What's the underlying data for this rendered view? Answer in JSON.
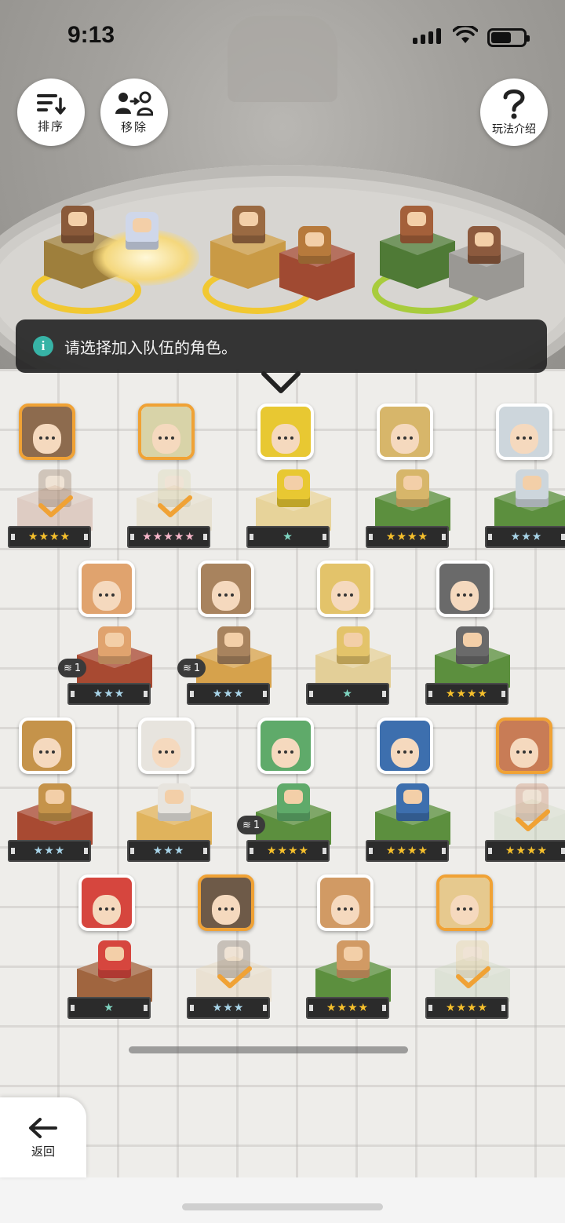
{
  "status": {
    "time": "9:13"
  },
  "toolbar": {
    "sort_label": "排序",
    "remove_label": "移除",
    "help_label": "玩法介绍",
    "back_label": "返回"
  },
  "banner": {
    "text": "请选择加入队伍的角色。"
  },
  "colors": {
    "owned_frame": "#f0a235",
    "fire": "#d93a3a",
    "lightning": "#f0b414",
    "wind": "#46b43c",
    "light": "#e3b640"
  },
  "characters": [
    {
      "element": "fire",
      "stars": "★★★★",
      "star_style": "gold",
      "owned": true,
      "selected": true,
      "duplicate": ""
    },
    {
      "element": "lightning",
      "stars": "★★★★★",
      "star_style": "rainbow",
      "owned": true,
      "selected": true,
      "duplicate": ""
    },
    {
      "element": "lightning",
      "stars": "★",
      "star_style": "teal",
      "owned": false,
      "selected": false,
      "duplicate": ""
    },
    {
      "element": "wind",
      "stars": "★★★★",
      "star_style": "gold",
      "owned": false,
      "selected": false,
      "duplicate": ""
    },
    {
      "element": "wind",
      "stars": "★★★",
      "star_style": "silver",
      "owned": false,
      "selected": false,
      "duplicate": ""
    },
    {
      "element": "fire",
      "stars": "★★★",
      "star_style": "silver",
      "owned": false,
      "selected": false,
      "duplicate": "1"
    },
    {
      "element": "lightning",
      "stars": "★★★",
      "star_style": "silver",
      "owned": false,
      "selected": false,
      "duplicate": "1"
    },
    {
      "element": "lightning",
      "stars": "★",
      "star_style": "teal",
      "owned": false,
      "selected": false,
      "duplicate": ""
    },
    {
      "element": "wind",
      "stars": "★★★★",
      "star_style": "gold",
      "owned": false,
      "selected": false,
      "duplicate": ""
    },
    {
      "element": "fire",
      "stars": "★★★",
      "star_style": "silver",
      "owned": false,
      "selected": false,
      "duplicate": ""
    },
    {
      "element": "lightning",
      "stars": "★★★",
      "star_style": "silver",
      "owned": false,
      "selected": false,
      "duplicate": ""
    },
    {
      "element": "wind",
      "stars": "★★★★",
      "star_style": "gold",
      "owned": false,
      "selected": false,
      "duplicate": "1"
    },
    {
      "element": "wind",
      "stars": "★★★★",
      "star_style": "gold",
      "owned": false,
      "selected": false,
      "duplicate": ""
    },
    {
      "element": "light",
      "stars": "★★★★",
      "star_style": "gold",
      "owned": true,
      "selected": true,
      "duplicate": ""
    },
    {
      "element": "fire",
      "stars": "★",
      "star_style": "teal",
      "owned": false,
      "selected": false,
      "duplicate": ""
    },
    {
      "element": "lightning",
      "stars": "★★★",
      "star_style": "silver",
      "owned": true,
      "selected": true,
      "duplicate": ""
    },
    {
      "element": "wind",
      "stars": "★★★★",
      "star_style": "gold",
      "owned": false,
      "selected": false,
      "duplicate": ""
    },
    {
      "element": "wind",
      "stars": "★★★★",
      "star_style": "gold",
      "owned": true,
      "selected": true,
      "duplicate": ""
    }
  ]
}
